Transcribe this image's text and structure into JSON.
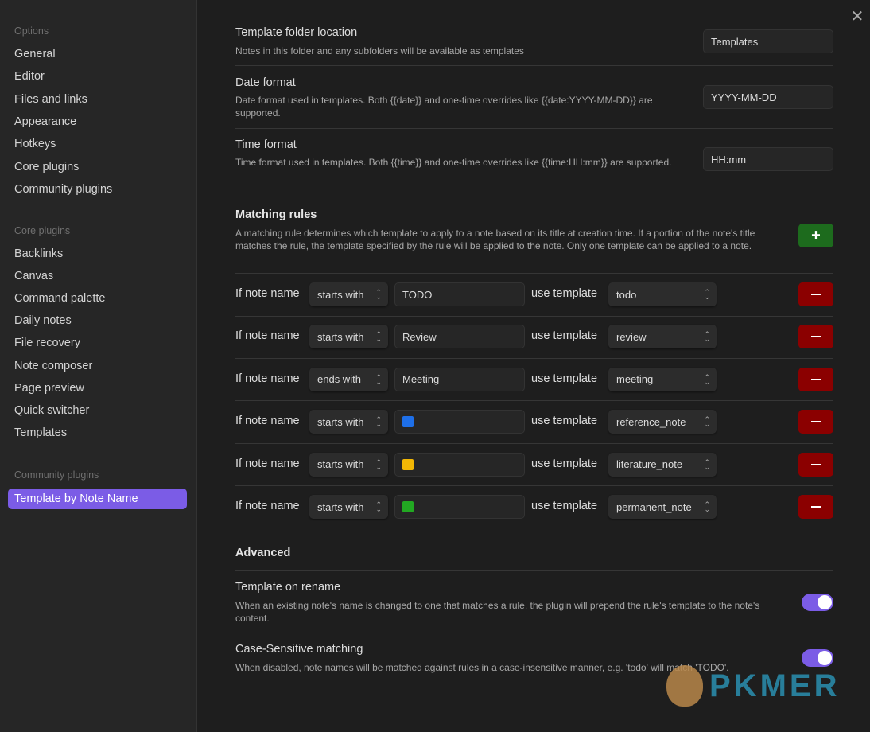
{
  "sidebar": {
    "options_heading": "Options",
    "options": [
      "General",
      "Editor",
      "Files and links",
      "Appearance",
      "Hotkeys",
      "Core plugins",
      "Community plugins"
    ],
    "core_heading": "Core plugins",
    "core": [
      "Backlinks",
      "Canvas",
      "Command palette",
      "Daily notes",
      "File recovery",
      "Note composer",
      "Page preview",
      "Quick switcher",
      "Templates"
    ],
    "community_heading": "Community plugins",
    "community": [
      "Template by Note Name"
    ]
  },
  "settings": {
    "folder": {
      "title": "Template folder location",
      "desc": "Notes in this folder and any subfolders will be available as templates",
      "value": "Templates"
    },
    "date": {
      "title": "Date format",
      "desc": "Date format used in templates. Both {{date}} and one-time overrides like {{date:YYYY-MM-DD}} are supported.",
      "value": "YYYY-MM-DD"
    },
    "time": {
      "title": "Time format",
      "desc": "Time format used in templates. Both {{time}} and one-time overrides like {{time:HH:mm}} are supported.",
      "value": "HH:mm"
    }
  },
  "matching": {
    "title": "Matching rules",
    "desc": "A matching rule determines which template to apply to a note based on its title at creation time. If a portion of the note's title matches the rule, the template specified by the rule will be applied to the note. Only one template can be applied to a note.",
    "add_label": "+",
    "prefix": "If note name",
    "mid": "use template",
    "rules": [
      {
        "op": "starts with",
        "value": "TODO",
        "template": "todo"
      },
      {
        "op": "starts with",
        "value": "Review",
        "template": "review"
      },
      {
        "op": "ends with",
        "value": "Meeting",
        "template": "meeting"
      },
      {
        "op": "starts with",
        "value": "",
        "icon_color": "#1e6fe8",
        "template": "reference_note"
      },
      {
        "op": "starts with",
        "value": "",
        "icon_color": "#f2b705",
        "template": "literature_note"
      },
      {
        "op": "starts with",
        "value": "",
        "icon_color": "#22a822",
        "template": "permanent_note"
      }
    ]
  },
  "advanced": {
    "title": "Advanced",
    "rename": {
      "title": "Template on rename",
      "desc": "When an existing note's name is changed to one that matches a rule, the plugin will prepend the rule's template to the note's content.",
      "enabled": true
    },
    "case": {
      "title": "Case-Sensitive matching",
      "desc": "When disabled, note names will be matched against rules in a case-insensitive manner, e.g. 'todo' will match 'TODO'.",
      "enabled": true
    }
  },
  "watermark": "PKMER",
  "accent": "#7b5ce6"
}
